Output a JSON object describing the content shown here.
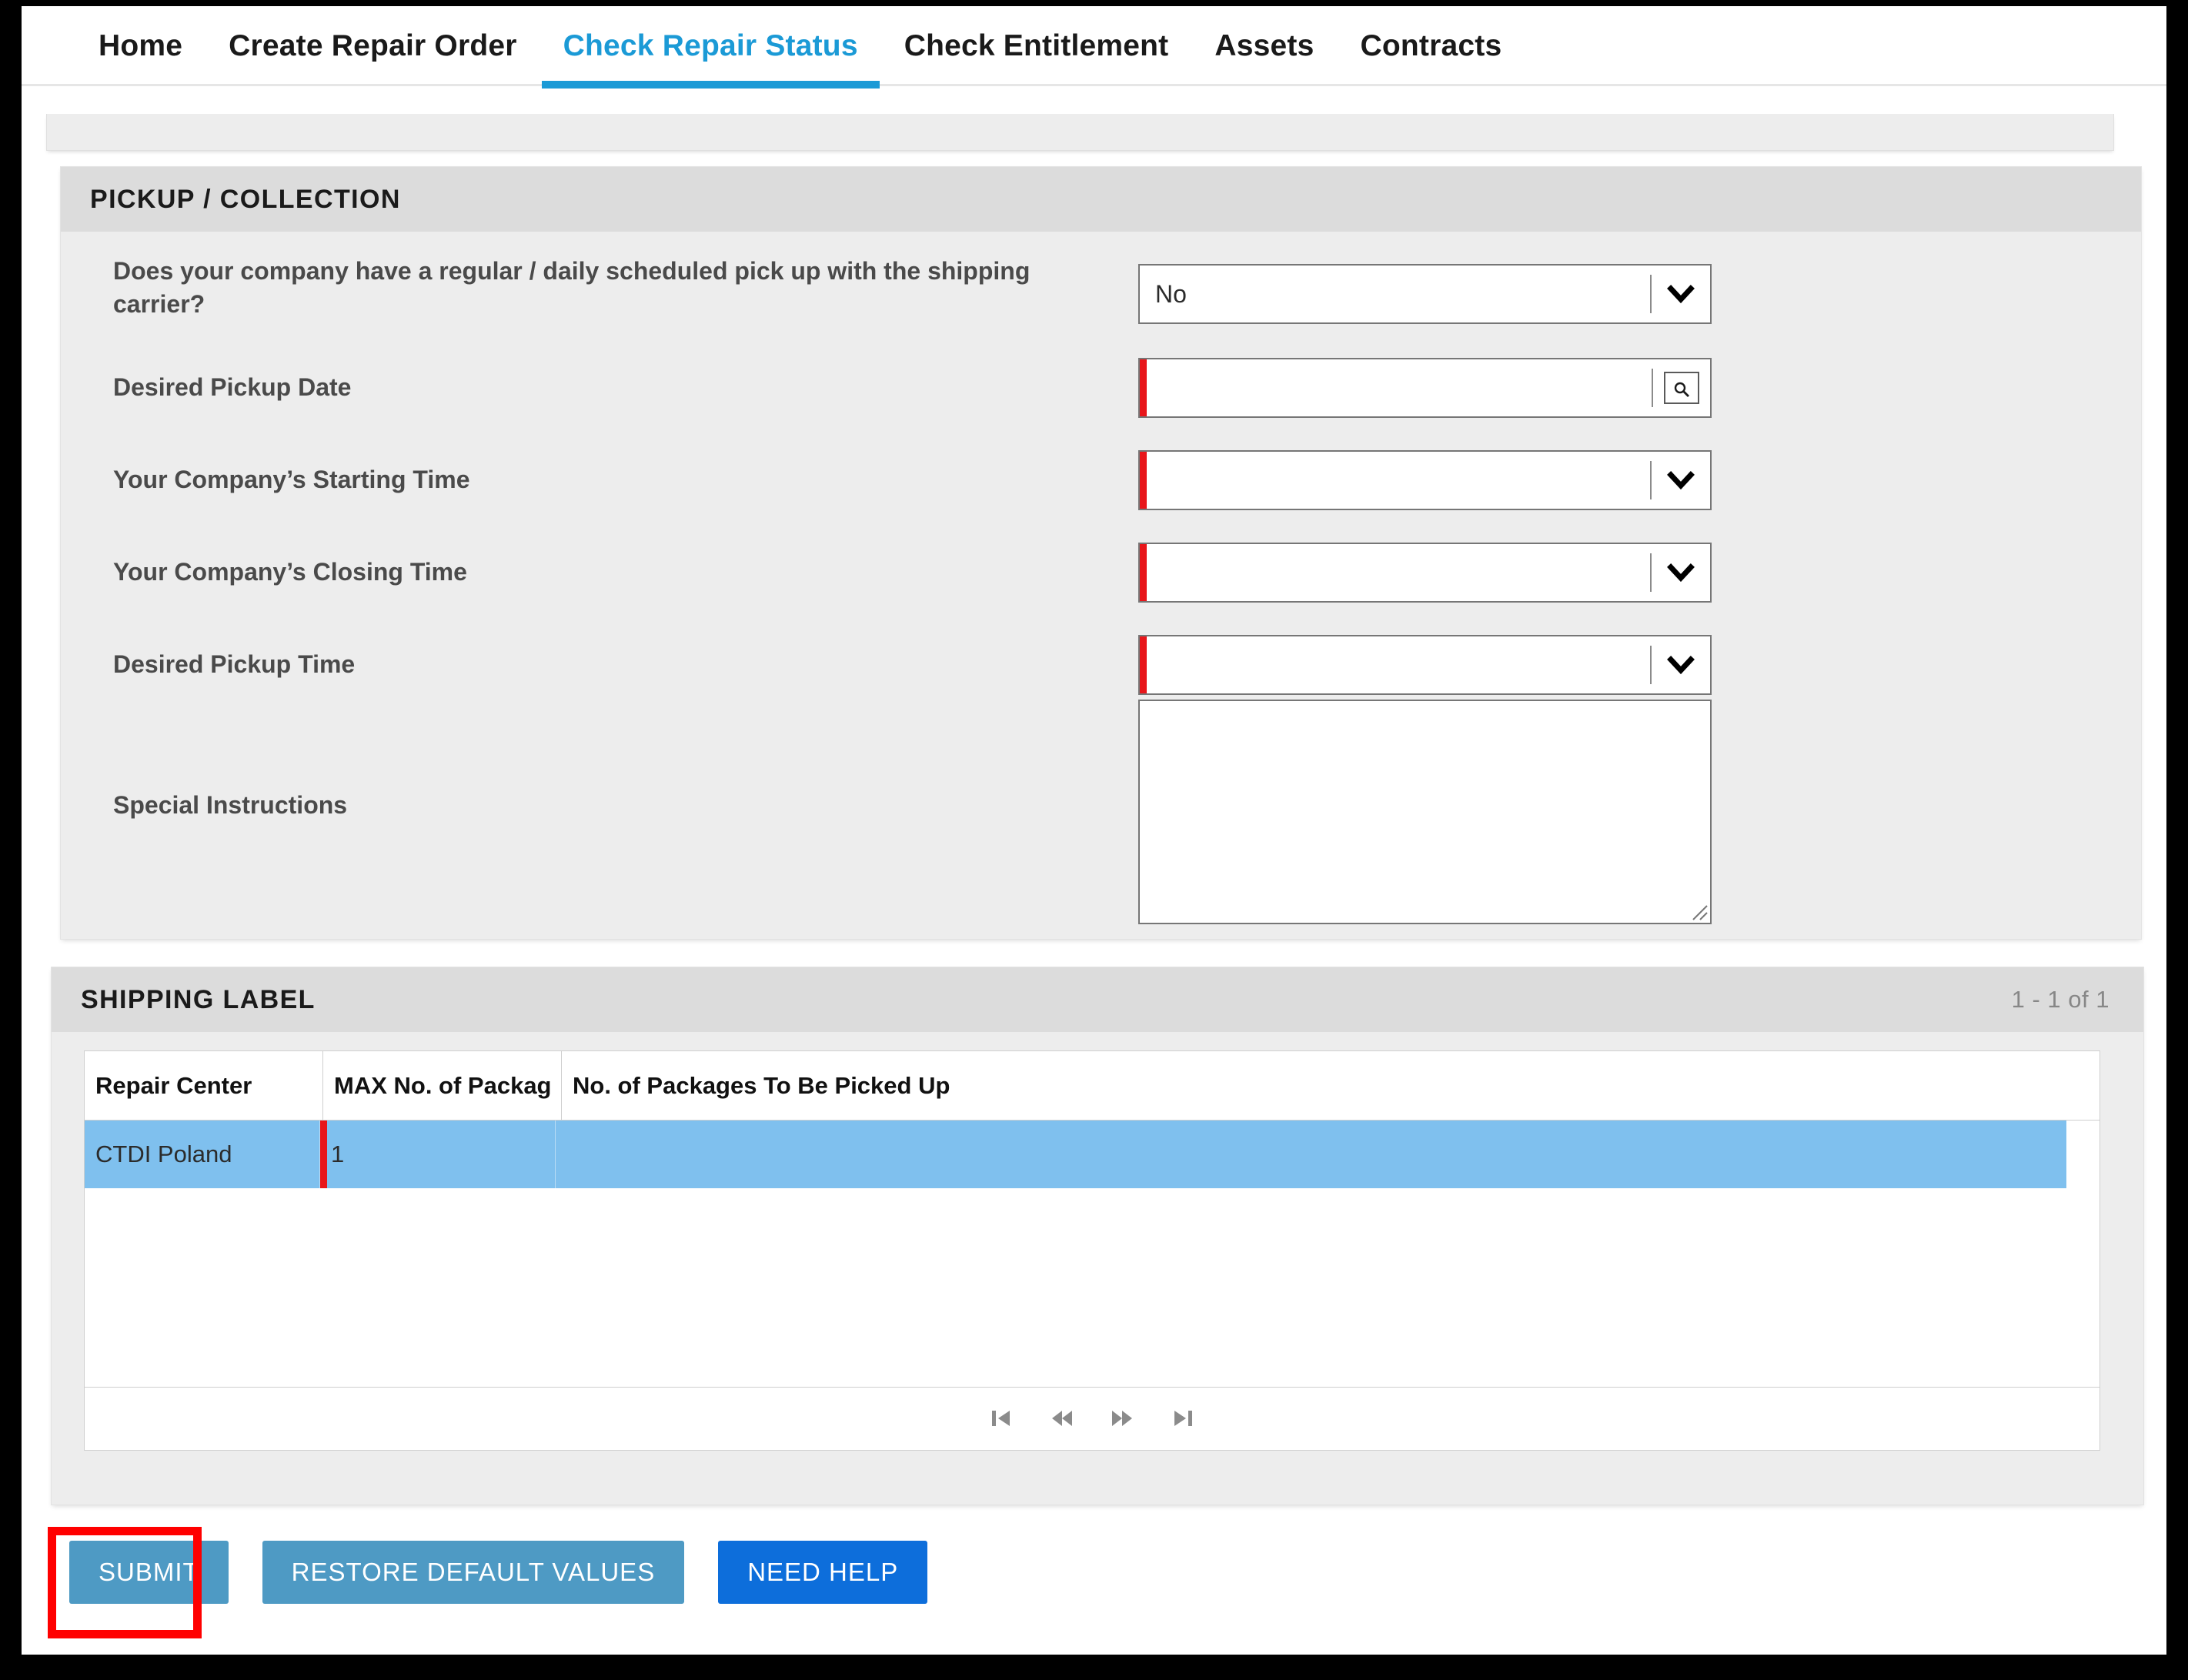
{
  "nav": {
    "items": [
      {
        "label": "Home",
        "active": false
      },
      {
        "label": "Create Repair Order",
        "active": false
      },
      {
        "label": "Check Repair Status",
        "active": true
      },
      {
        "label": "Check Entitlement",
        "active": false
      },
      {
        "label": "Assets",
        "active": false
      },
      {
        "label": "Contracts",
        "active": false
      }
    ]
  },
  "pickup": {
    "title": "PICKUP / COLLECTION",
    "fields": {
      "scheduled_pickup": {
        "label": "Does your company have a regular / daily scheduled pick up with the shipping carrier?",
        "value": "No",
        "type": "select",
        "required": false
      },
      "desired_pickup_date": {
        "label": "Desired Pickup Date",
        "value": "",
        "type": "datepicker",
        "required": true
      },
      "starting_time": {
        "label": "Your Company’s Starting Time",
        "value": "",
        "type": "select",
        "required": true
      },
      "closing_time": {
        "label": "Your Company’s Closing Time",
        "value": "",
        "type": "select",
        "required": true
      },
      "desired_pickup_time": {
        "label": "Desired Pickup Time",
        "value": "",
        "type": "select",
        "required": true
      },
      "special_instructions": {
        "label": "Special Instructions",
        "value": "",
        "type": "textarea",
        "required": false
      }
    }
  },
  "shipping": {
    "title": "SHIPPING LABEL",
    "record_count": "1 - 1 of 1",
    "table": {
      "columns": [
        "Repair Center",
        "MAX No. of Packag",
        "No. of Packages To Be Picked Up"
      ],
      "rows": [
        {
          "repair_center": "CTDI Poland",
          "max_no_of_packages": "1",
          "no_of_packages_to_be_picked_up": "",
          "selected": true
        }
      ]
    },
    "pager": {
      "first": "first-page-icon",
      "previous": "previous-page-icon",
      "next": "next-page-icon",
      "last": "last-page-icon"
    }
  },
  "actions": {
    "submit": "SUBMIT",
    "restore": "RESTORE DEFAULT VALUES",
    "help": "NEED HELP"
  },
  "colors": {
    "accent_blue": "#1b9ad6",
    "button_blue": "#4e9ac4",
    "primary_blue": "#0d6edb",
    "row_selected": "#7fc0ee",
    "required_red": "#e8161a",
    "annotation_red": "#ff0000"
  }
}
